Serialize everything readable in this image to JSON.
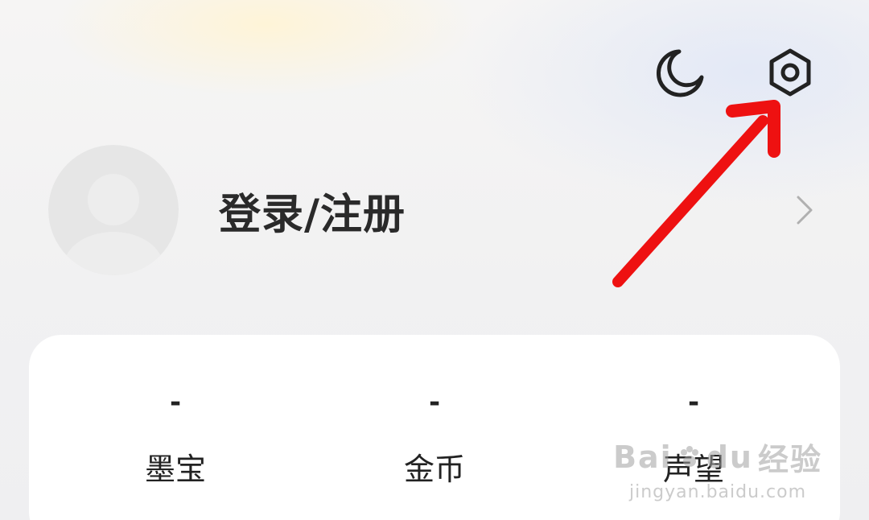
{
  "header": {
    "night_mode_icon": "moon-icon",
    "settings_icon": "gear-icon"
  },
  "profile": {
    "avatar_icon": "default-avatar",
    "login_label": "登录/注册",
    "chevron_icon": "chevron-right-icon"
  },
  "stats": [
    {
      "value": "-",
      "label": "墨宝"
    },
    {
      "value": "-",
      "label": "金币"
    },
    {
      "value": "-",
      "label": "声望"
    }
  ],
  "annotation": {
    "color": "#ee1111"
  },
  "watermark": {
    "logo_text": "Bai",
    "du_text": "du",
    "brand_text": "经验",
    "url_text": "jingyan.baidu.com"
  }
}
